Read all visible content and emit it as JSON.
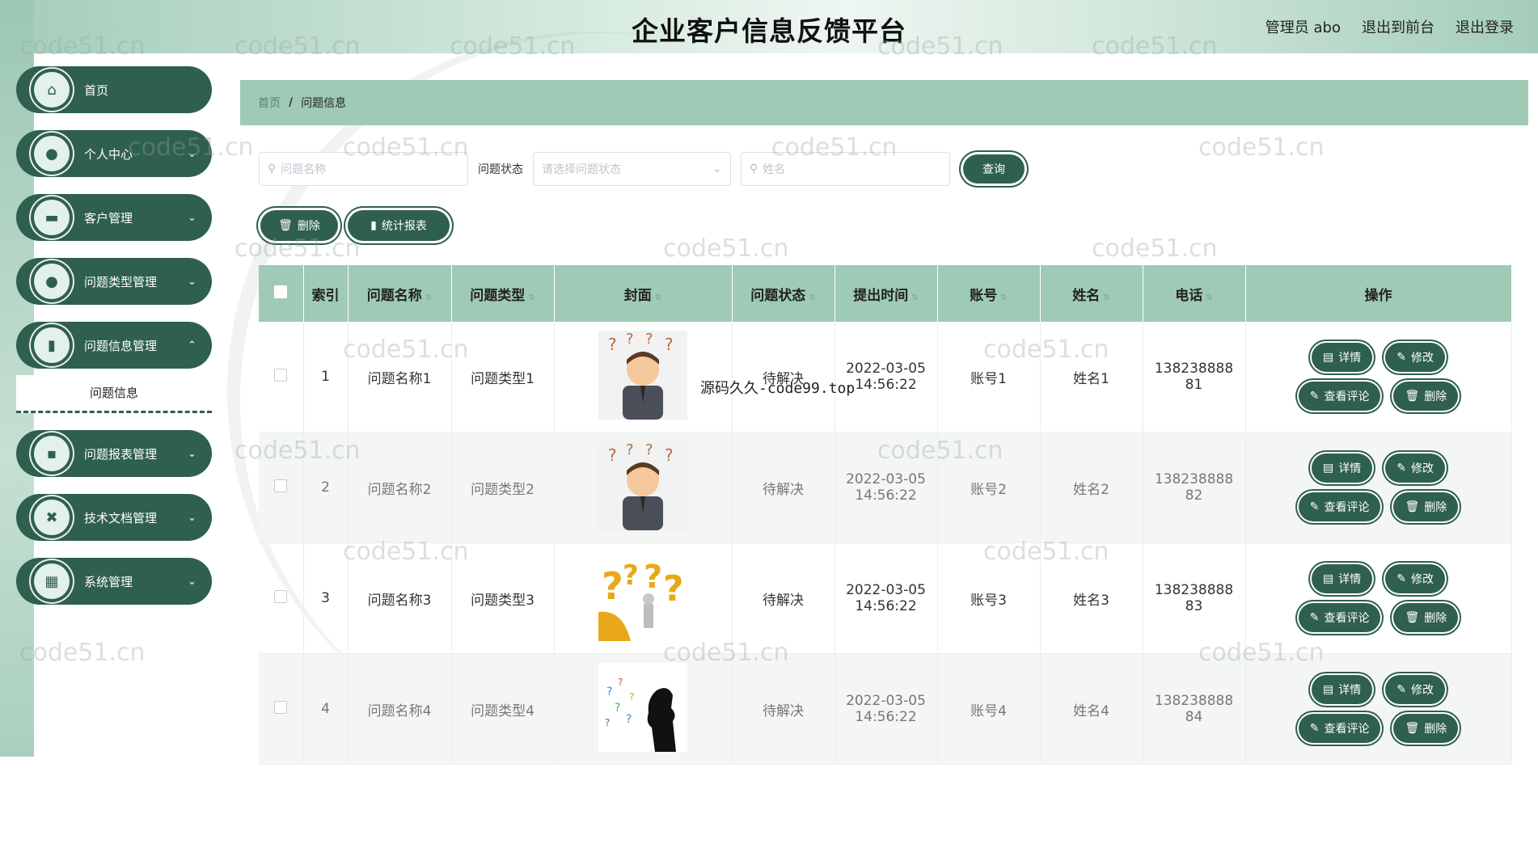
{
  "header": {
    "title": "企业客户信息反馈平台",
    "user": "管理员 abo",
    "to_front": "退出到前台",
    "logout": "退出登录"
  },
  "sidebar": {
    "items": [
      {
        "label": "首页",
        "icon": "home-icon"
      },
      {
        "label": "个人中心",
        "icon": "user-icon"
      },
      {
        "label": "客户管理",
        "icon": "monitor-icon"
      },
      {
        "label": "问题类型管理",
        "icon": "user-icon"
      },
      {
        "label": "问题信息管理",
        "icon": "clipboard-icon"
      },
      {
        "label": "问题报表管理",
        "icon": "chat-icon"
      },
      {
        "label": "技术文档管理",
        "icon": "ticket-icon"
      },
      {
        "label": "系统管理",
        "icon": "grid-icon"
      }
    ],
    "submenu": "问题信息"
  },
  "breadcrumb": {
    "home": "首页",
    "separator": "/",
    "current": "问题信息"
  },
  "search": {
    "name_placeholder": "问题名称",
    "status_label": "问题状态",
    "status_placeholder": "请选择问题状态",
    "person_placeholder": "姓名",
    "query_button": "查询"
  },
  "actions": {
    "delete": "删除",
    "report": "统计报表"
  },
  "table": {
    "headers": [
      "索引",
      "问题名称",
      "问题类型",
      "封面",
      "问题状态",
      "提出时间",
      "账号",
      "姓名",
      "电话",
      "操作"
    ],
    "rows": [
      {
        "index": "1",
        "name": "问题名称1",
        "type": "问题类型1",
        "status": "待解决",
        "time": "2022-03-05 14:56:22",
        "account": "账号1",
        "person": "姓名1",
        "phone": "13823888881"
      },
      {
        "index": "2",
        "name": "问题名称2",
        "type": "问题类型2",
        "status": "待解决",
        "time": "2022-03-05 14:56:22",
        "account": "账号2",
        "person": "姓名2",
        "phone": "13823888882"
      },
      {
        "index": "3",
        "name": "问题名称3",
        "type": "问题类型3",
        "status": "待解决",
        "time": "2022-03-05 14:56:22",
        "account": "账号3",
        "person": "姓名3",
        "phone": "13823888883"
      },
      {
        "index": "4",
        "name": "问题名称4",
        "type": "问题类型4",
        "status": "待解决",
        "time": "2022-03-05 14:56:22",
        "account": "账号4",
        "person": "姓名4",
        "phone": "13823888884"
      }
    ],
    "ops": {
      "detail": "详情",
      "edit": "修改",
      "comments": "查看评论",
      "delete": "删除"
    }
  },
  "overlay": "源码久久-code99.top",
  "watermark": "code51.cn",
  "colors": {
    "primary": "#2f5f4f",
    "accent": "#9fcab5"
  }
}
